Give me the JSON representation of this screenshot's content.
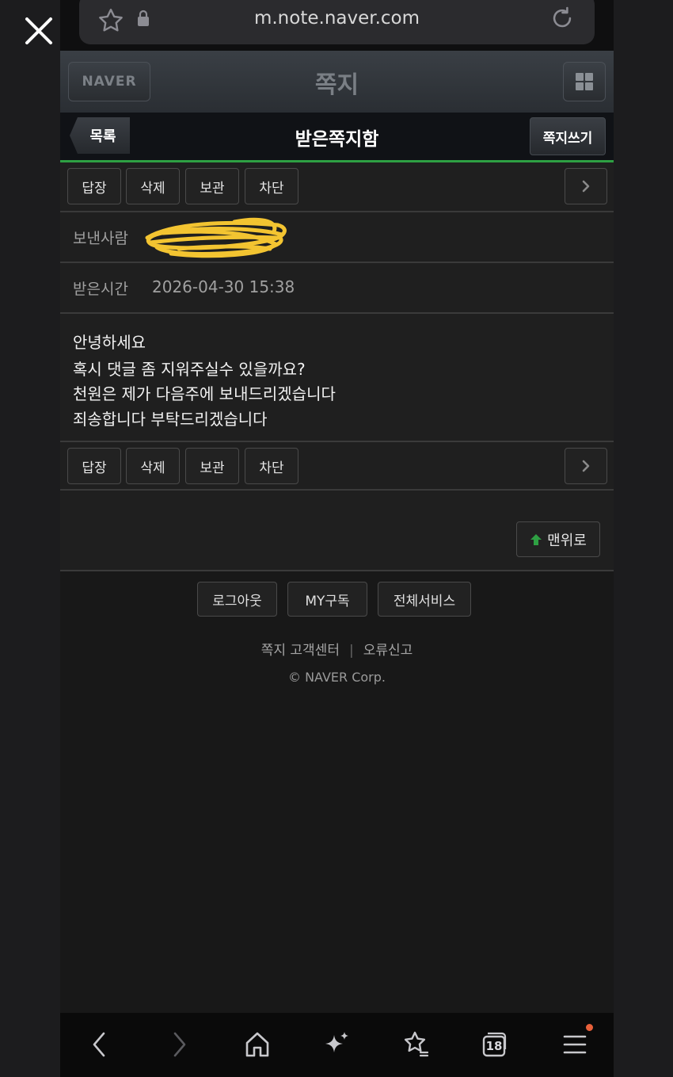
{
  "browser": {
    "url": "m.note.naver.com",
    "icons": [
      "close-icon",
      "star-icon",
      "lock-icon",
      "reload-icon"
    ]
  },
  "header": {
    "logo": "NAVER",
    "title": "쪽지"
  },
  "subheader": {
    "back_label": "목록",
    "title": "받은쪽지함",
    "write_label": "쪽지쓰기"
  },
  "toolbar": {
    "reply": "답장",
    "delete": "삭제",
    "keep": "보관",
    "block": "차단"
  },
  "message": {
    "sender_label": "보낸사람",
    "time_label": "받은시간",
    "time_value": "2026-04-30 15:38",
    "lines": [
      "안녕하세요",
      "혹시 댓글 좀 지워주실수 있을까요?",
      "천원은 제가 다음주에 보내드리겠습니다",
      "죄송합니다 부탁드리겠습니다"
    ]
  },
  "top_button": "맨위로",
  "footer": {
    "logout": "로그아웃",
    "my_subscribe": "MY구독",
    "all_services": "전체서비스",
    "help_center": "쪽지 고객센터",
    "divider": "|",
    "report": "오류신고",
    "copyright": "© NAVER Corp."
  },
  "bottom_nav": {
    "tabs_count": "18",
    "icons": [
      "back-icon",
      "forward-icon",
      "home-icon",
      "sparkle-icon",
      "favorites-icon",
      "tabs-icon",
      "menu-icon"
    ],
    "notification_color": "#e8603a"
  },
  "colors": {
    "accent_green": "#2ea043"
  }
}
